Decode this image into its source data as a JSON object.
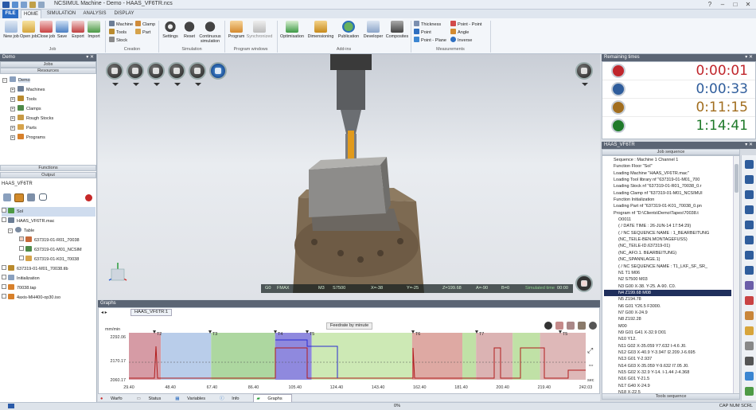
{
  "window": {
    "title": "NCSIMUL Machine - Demo - HAAS_VF6TR.ncs",
    "controls": [
      "?",
      "–",
      "□",
      "✕"
    ]
  },
  "ribbon_tabs": [
    "FILE",
    "HOME",
    "SIMULATION",
    "ANALYSIS",
    "DISPLAY"
  ],
  "ribbon": {
    "job": {
      "label": "Job",
      "buttons": [
        "New job",
        "Open job",
        "Close job",
        "Save",
        "Export",
        "Import"
      ]
    },
    "creation": {
      "label": "Creation",
      "items": [
        "Machine",
        "Tools",
        "Stock",
        "Clamp",
        "Part"
      ]
    },
    "simulation": {
      "label": "Simulation",
      "buttons": [
        "Settings",
        "Reset",
        "Continuous simulation"
      ]
    },
    "program_windows": {
      "label": "Program windows",
      "buttons": [
        "Program",
        "Synchronized"
      ]
    },
    "addins": {
      "label": "Add-ins",
      "buttons": [
        "Optimisation",
        "Dimensioning",
        "Publication",
        "Developer",
        "Composites"
      ]
    },
    "measurements": {
      "label": "Measurements",
      "items": [
        "Thickness",
        "Point",
        "Point - Plane",
        "Point - Point",
        "Angle",
        "Inverse"
      ]
    }
  },
  "left_panel": {
    "title": "Demo",
    "sections": {
      "jobs": "Jobs",
      "resources": "Resources",
      "functions": "Functions",
      "output": "Output"
    },
    "tree": [
      "Demo",
      "Machines",
      "Tools",
      "Clamps",
      "Rough Stocks",
      "Parts",
      "Programs"
    ],
    "output_title": "HAAS_VF6TR",
    "output_tree": [
      "Sol",
      "HAAS_VF6TR.mac",
      "Table",
      "637319-01-R01_70038",
      "637319-01-M01_NCSIM",
      "637319-01-K01_70038",
      "637319-01-M01_70038.tlb",
      "Initialization",
      "70038.tap",
      "4axis-MH400-op30.iso"
    ]
  },
  "viewport": {
    "status": [
      "G0",
      "FMAX",
      "M3",
      "S7500",
      "X=-38",
      "Y=-25",
      "Z=199.68",
      "A=-90",
      "B=0",
      "Simulated time",
      "00:00"
    ]
  },
  "graphs": {
    "panel_title": "Graphs",
    "tab": "HAAS_VF6TR:1",
    "caption": "Feedrate by minute",
    "y_unit": "mm/min",
    "x_unit": "sec",
    "y_ticks": [
      "2292.06",
      "2170.17",
      "2060.17"
    ],
    "x_ticks": [
      "29.40",
      "48.40",
      "67.40",
      "86.40",
      "105.40",
      "124.40",
      "143.40",
      "162.40",
      "181.40",
      "200.40",
      "219.40",
      "242.03"
    ],
    "markers": [
      "T2",
      "T3",
      "T4",
      "T5",
      "T6",
      "T7",
      "T5"
    ],
    "bottom_tabs": [
      "Warfo",
      "Status",
      "Variables",
      "Info",
      "Graphs"
    ]
  },
  "remaining_times": {
    "title": "Remaining times",
    "values": [
      "0:00:01",
      "0:00:33",
      "0:11:15",
      "1:14:41"
    ],
    "colors": [
      "#c0262c",
      "#2f5d9c",
      "#a26e1f",
      "#1f7a2a"
    ]
  },
  "job_sequence": {
    "panel_title": "HAAS_VF6TR",
    "header": "Job sequence",
    "footer": "Tools sequence",
    "lines": [
      "Sequence : Machine 1 Channel 1",
      "Function Floor \"Sol\"",
      "Loading Machine \"HAAS_VF6TR.mac\"",
      "Loading Tool library nf \"637319-01-M01_700",
      "Loading Stock nf \"637319-01-R01_70038_0.r",
      "Loading Clamp nf \"637319-01-M01_NCSIMUI",
      "Function Initialization",
      "Loading Part nf \"637319-01-K01_70038_0.pn",
      "Program nf \"D:\\Clients\\Demo\\Tapes\\70038.t",
      "O0011",
      "( / DATE TIME : 26-JUN-14 17:54:29)",
      "( / NC SEQUENCE NAME : 1_BEARBEITUNG",
      "(NC_TEILE-BEN.MONTAGEFUSS)",
      "(NC_TEILE-ID.637319-01)",
      "(NC_AFO.1. BEARBEITUNG)",
      "(NC_SPANNLAGE.1)",
      "( / NC SEQUENCE NAME : T1_LKF_SF_SR_",
      "N1 T1 M06",
      "N2 S7500 M03",
      "N3 G00 X-38. Y-25. A-90. C0.",
      "N4 Z199.68 M08",
      "N5 Z194.78",
      "N6 G01 Y26.5 F3000.",
      "N7 G00 X-24.9",
      "N8 Z192.28",
      "M00",
      "N9 G01 G41 X-32.9 D01",
      "N10 Y12.",
      "N11 G02 X-35.059 Y7.632 I-4.6 J0.",
      "N12 G03 X-40.9 Y-3.947 I2.209 J-6.695",
      "N13 G01 Y-2.937",
      "N14 G03 X-35.059 Y-9.632 I7.05 J0.",
      "N15 G02 X-32.9 Y-14. I-1.44 J-4.368",
      "N16 G01 Y-21.5",
      "N17 G40 X-24.9",
      "N18 X-22.5"
    ]
  },
  "statusline": {
    "progress": "0%",
    "indicators": "CAP  NUM  SCRL"
  }
}
